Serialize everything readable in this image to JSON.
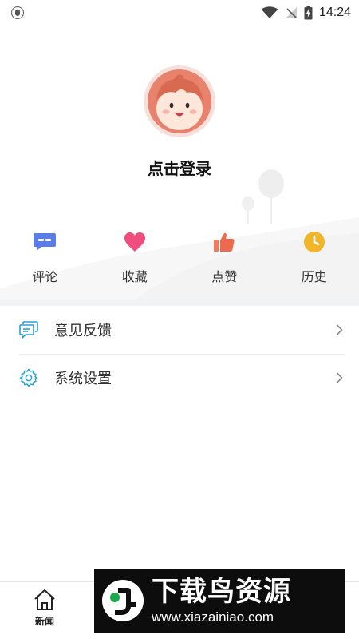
{
  "status_bar": {
    "time": "14:24"
  },
  "profile": {
    "login_label": "点击登录"
  },
  "shortcuts": [
    {
      "label": "评论",
      "icon": "comment-icon",
      "color": "#5b7de8"
    },
    {
      "label": "收藏",
      "icon": "heart-icon",
      "color": "#ef4f7f"
    },
    {
      "label": "点赞",
      "icon": "thumbs-up-icon",
      "color": "#ee6a4f"
    },
    {
      "label": "历史",
      "icon": "clock-icon",
      "color": "#f2b529"
    }
  ],
  "menu": [
    {
      "label": "意见反馈",
      "icon": "feedback-icon"
    },
    {
      "label": "系统设置",
      "icon": "settings-icon"
    }
  ],
  "tab_bar": {
    "news_label": "新闻"
  },
  "watermark": {
    "title": "下载鸟资源",
    "url": "www.xiazainiao.com"
  },
  "colors": {
    "menu_icon": "#2aa0d8",
    "divider": "#f2f3f5"
  }
}
